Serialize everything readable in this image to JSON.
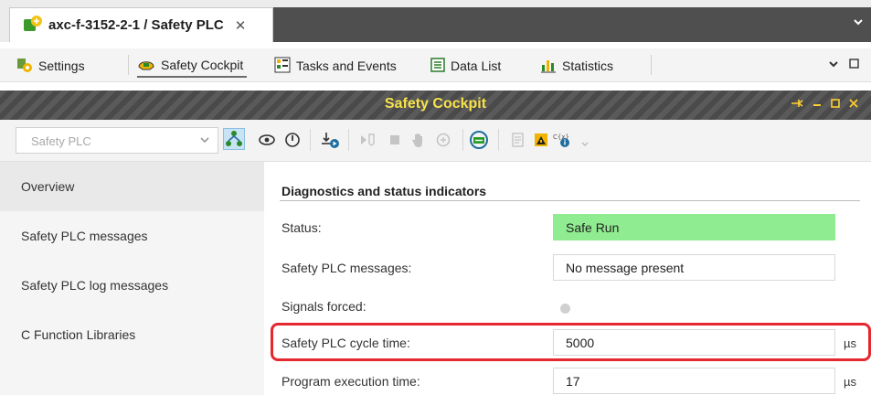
{
  "editor_tab": {
    "title": "axc-f-3152-2-1 / Safety PLC",
    "close_glyph": "✕"
  },
  "sub_tabs": [
    {
      "label": "Settings",
      "icon": "settings-icon"
    },
    {
      "label": "Safety Cockpit",
      "icon": "safety-cockpit-icon",
      "active": true
    },
    {
      "label": "Tasks and Events",
      "icon": "tasks-icon"
    },
    {
      "label": "Data List",
      "icon": "data-list-icon"
    },
    {
      "label": "Statistics",
      "icon": "statistics-icon"
    }
  ],
  "cockpit": {
    "title": "Safety Cockpit",
    "plc_selector": "Safety PLC"
  },
  "nav": [
    {
      "label": "Overview",
      "active": true
    },
    {
      "label": "Safety PLC messages"
    },
    {
      "label": "Safety PLC log messages"
    },
    {
      "label": "C Function Libraries"
    }
  ],
  "diagnostics": {
    "section_title": "Diagnostics and status indicators",
    "status_label": "Status:",
    "status_value": "Safe Run",
    "messages_label": "Safety PLC messages:",
    "messages_value": "No message present",
    "forced_label": "Signals forced:",
    "cycle_label": "Safety PLC cycle time:",
    "cycle_value": "5000",
    "cycle_unit": "µs",
    "exec_label": "Program execution time:",
    "exec_value": "17",
    "exec_unit": "µs"
  },
  "colors": {
    "safe_run": "#90ec90",
    "highlight": "#e5282f",
    "header_title": "#f7e24a"
  }
}
